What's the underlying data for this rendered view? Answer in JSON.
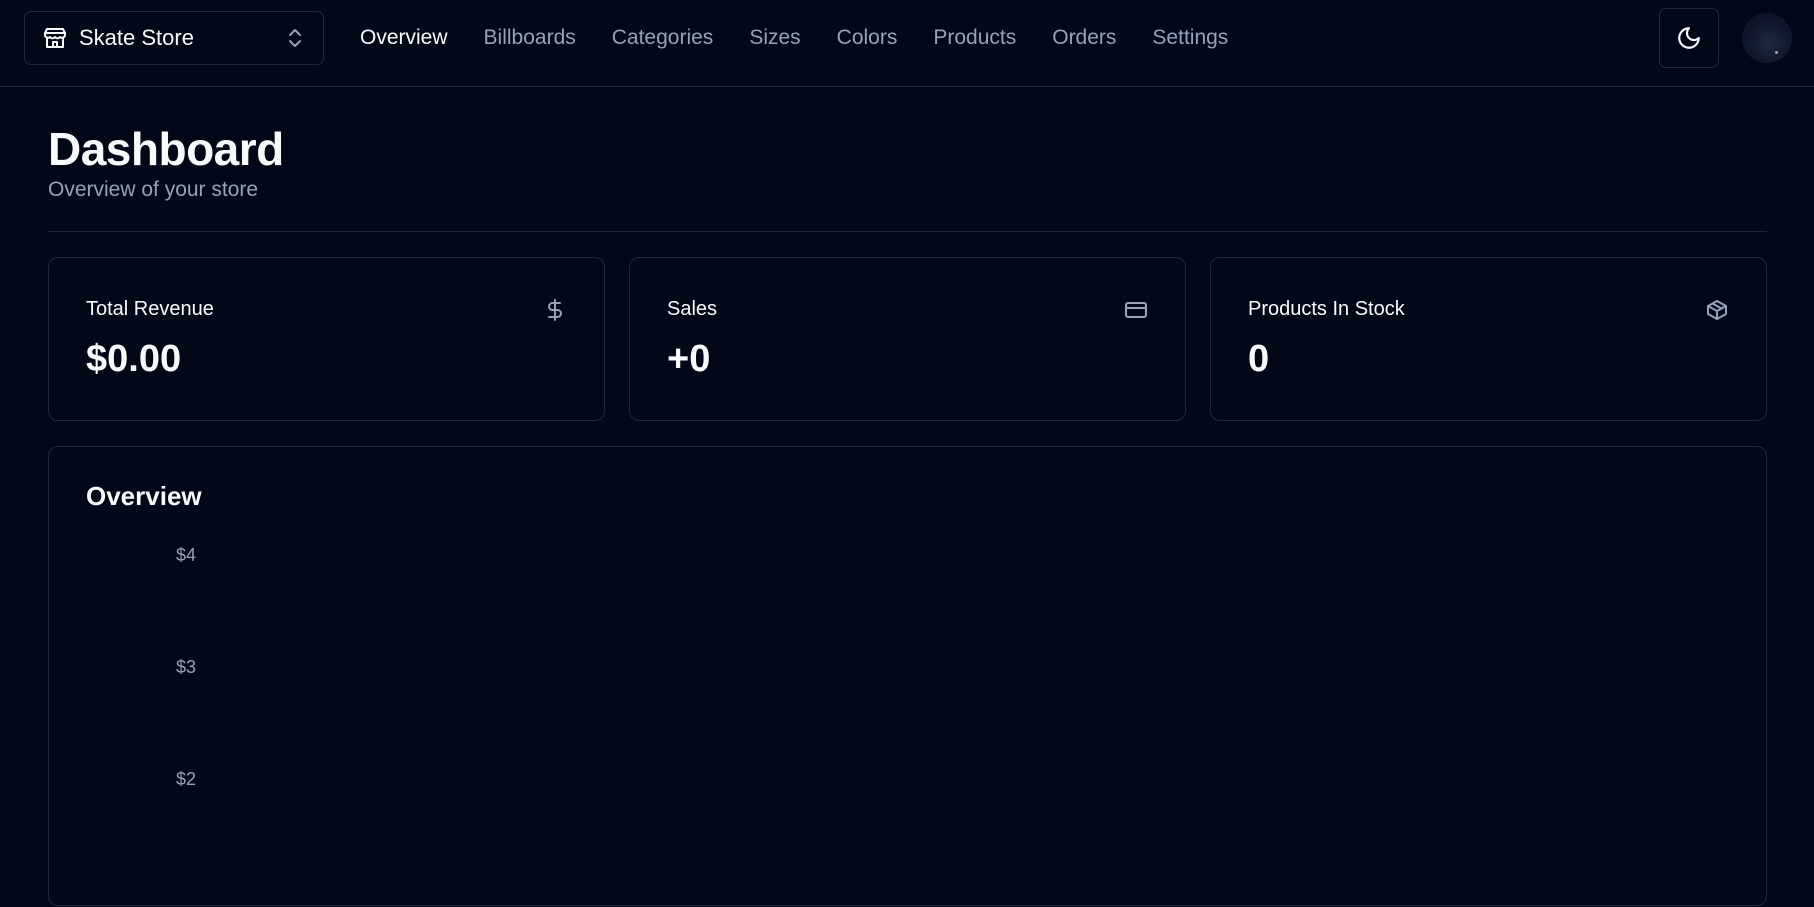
{
  "navbar": {
    "store_name": "Skate Store",
    "links": [
      {
        "label": "Overview",
        "active": true
      },
      {
        "label": "Billboards",
        "active": false
      },
      {
        "label": "Categories",
        "active": false
      },
      {
        "label": "Sizes",
        "active": false
      },
      {
        "label": "Colors",
        "active": false
      },
      {
        "label": "Products",
        "active": false
      },
      {
        "label": "Orders",
        "active": false
      },
      {
        "label": "Settings",
        "active": false
      }
    ],
    "theme_icon": "moon-icon"
  },
  "header": {
    "title": "Dashboard",
    "subtitle": "Overview of your store"
  },
  "cards": [
    {
      "label": "Total Revenue",
      "value": "$0.00",
      "icon": "dollar-icon"
    },
    {
      "label": "Sales",
      "value": "+0",
      "icon": "credit-card-icon"
    },
    {
      "label": "Products In Stock",
      "value": "0",
      "icon": "package-icon"
    }
  ],
  "overview": {
    "title": "Overview"
  },
  "chart_data": {
    "type": "bar",
    "title": "Overview",
    "y_tick_labels": [
      "$4",
      "$3",
      "$2"
    ],
    "ylim": [
      0,
      4
    ]
  },
  "colors": {
    "background": "#020817",
    "border": "#1e293b",
    "text": "#f8fafc",
    "muted": "#94a3b8"
  }
}
